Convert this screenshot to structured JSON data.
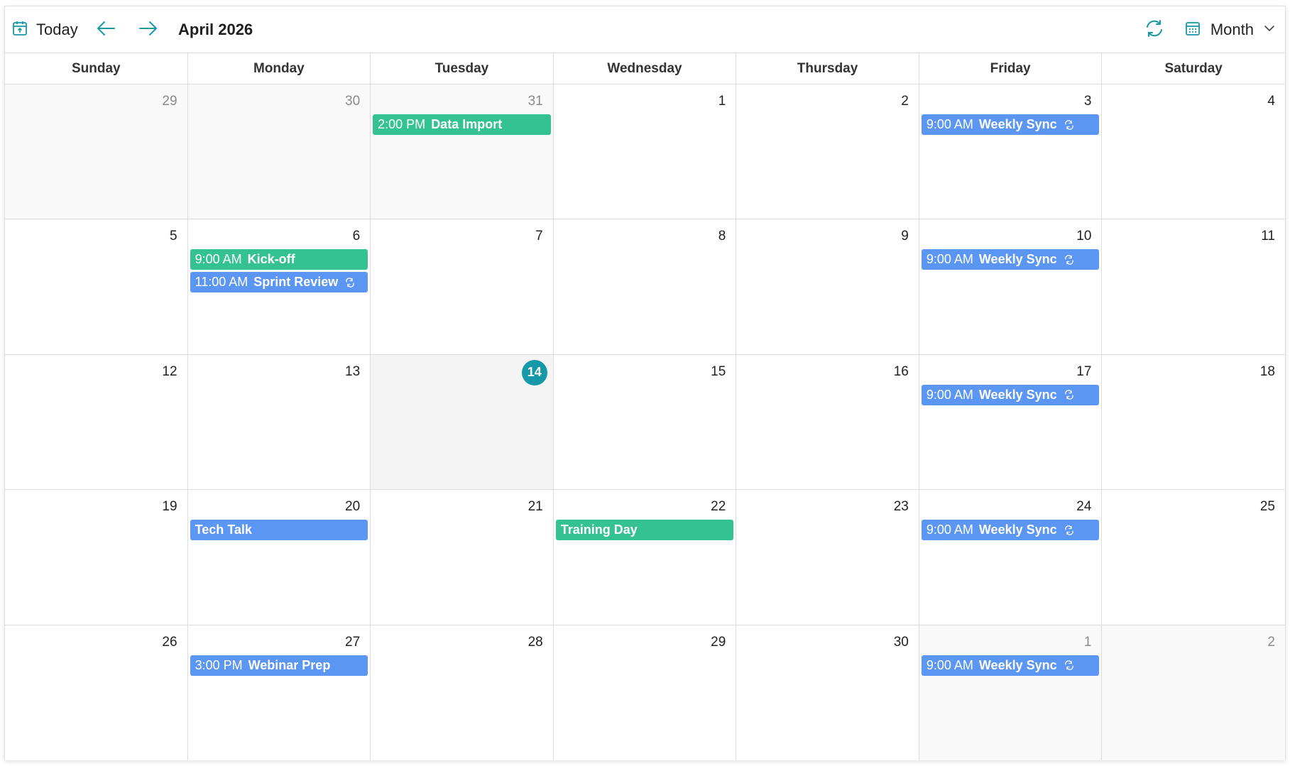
{
  "toolbar": {
    "today_label": "Today",
    "title": "April 2026",
    "view_label": "Month",
    "icons": {
      "today": "calendar-today-icon",
      "prev": "arrow-left-icon",
      "next": "arrow-right-icon",
      "refresh": "refresh-icon",
      "view": "calendar-grid-icon",
      "dropdown": "chevron-down-icon"
    }
  },
  "colors": {
    "accent": "#1598a8",
    "blue_event": "#5b96f3",
    "green_event": "#35c292",
    "other_month_bg": "#f9f9f9",
    "today_bg": "#f4f4f4"
  },
  "day_names": [
    "Sunday",
    "Monday",
    "Tuesday",
    "Wednesday",
    "Thursday",
    "Friday",
    "Saturday"
  ],
  "weeks": [
    [
      {
        "date": "29",
        "other": true
      },
      {
        "date": "30",
        "other": true
      },
      {
        "date": "31",
        "other": true,
        "events": [
          {
            "time": "2:00 PM",
            "subject": "Data Import",
            "color": "green"
          }
        ]
      },
      {
        "date": "1"
      },
      {
        "date": "2"
      },
      {
        "date": "3",
        "events": [
          {
            "time": "9:00 AM",
            "subject": "Weekly Sync",
            "color": "blue",
            "recurring": true
          }
        ]
      },
      {
        "date": "4"
      }
    ],
    [
      {
        "date": "5"
      },
      {
        "date": "6",
        "events": [
          {
            "time": "9:00 AM",
            "subject": "Kick-off",
            "color": "green"
          },
          {
            "time": "11:00 AM",
            "subject": "Sprint Review",
            "color": "blue",
            "recurring": true
          }
        ]
      },
      {
        "date": "7"
      },
      {
        "date": "8"
      },
      {
        "date": "9"
      },
      {
        "date": "10",
        "events": [
          {
            "time": "9:00 AM",
            "subject": "Weekly Sync",
            "color": "blue",
            "recurring": true
          }
        ]
      },
      {
        "date": "11"
      }
    ],
    [
      {
        "date": "12"
      },
      {
        "date": "13"
      },
      {
        "date": "14",
        "today": true
      },
      {
        "date": "15"
      },
      {
        "date": "16"
      },
      {
        "date": "17",
        "events": [
          {
            "time": "9:00 AM",
            "subject": "Weekly Sync",
            "color": "blue",
            "recurring": true
          }
        ]
      },
      {
        "date": "18"
      }
    ],
    [
      {
        "date": "19"
      },
      {
        "date": "20",
        "events": [
          {
            "time": "",
            "subject": "Tech Talk",
            "color": "blue"
          }
        ]
      },
      {
        "date": "21"
      },
      {
        "date": "22",
        "events": [
          {
            "time": "",
            "subject": "Training Day",
            "color": "green"
          }
        ]
      },
      {
        "date": "23"
      },
      {
        "date": "24",
        "events": [
          {
            "time": "9:00 AM",
            "subject": "Weekly Sync",
            "color": "blue",
            "recurring": true
          }
        ]
      },
      {
        "date": "25"
      }
    ],
    [
      {
        "date": "26"
      },
      {
        "date": "27",
        "events": [
          {
            "time": "3:00 PM",
            "subject": "Webinar Prep",
            "color": "blue"
          }
        ]
      },
      {
        "date": "28"
      },
      {
        "date": "29"
      },
      {
        "date": "30"
      },
      {
        "date": "1",
        "other": true,
        "events": [
          {
            "time": "9:00 AM",
            "subject": "Weekly Sync",
            "color": "blue",
            "recurring": true
          }
        ]
      },
      {
        "date": "2",
        "other": true
      }
    ]
  ]
}
